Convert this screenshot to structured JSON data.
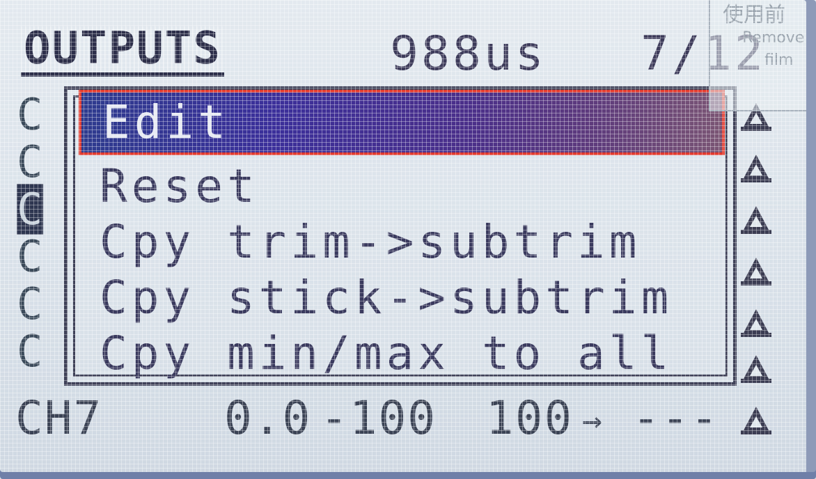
{
  "header": {
    "title": "OUTPUTS",
    "pulse_value": "988us",
    "page_indicator": "7/12"
  },
  "watermark": {
    "line1": "使用前",
    "line2": "Remove",
    "line3": "film"
  },
  "context_menu": {
    "items": [
      {
        "label": "Edit",
        "selected": true
      },
      {
        "label": "Reset"
      },
      {
        "label": "Cpy trim->subtrim"
      },
      {
        "label": "Cpy stick->subtrim"
      },
      {
        "label": "Cpy min/max to all"
      }
    ]
  },
  "background_rows": {
    "prefix": "C",
    "visible_row": {
      "channel": "CH7",
      "offset": "0.0",
      "min": "-100",
      "max": "100",
      "arrow": "→",
      "source": "---"
    }
  },
  "colors": {
    "highlight_start": "#2e3b8e",
    "highlight_end": "#7a5574",
    "focus_outline": "#e03a2e",
    "lcd_text": "#3a3a5e"
  },
  "icons": [
    "direction-triangle-icon"
  ]
}
